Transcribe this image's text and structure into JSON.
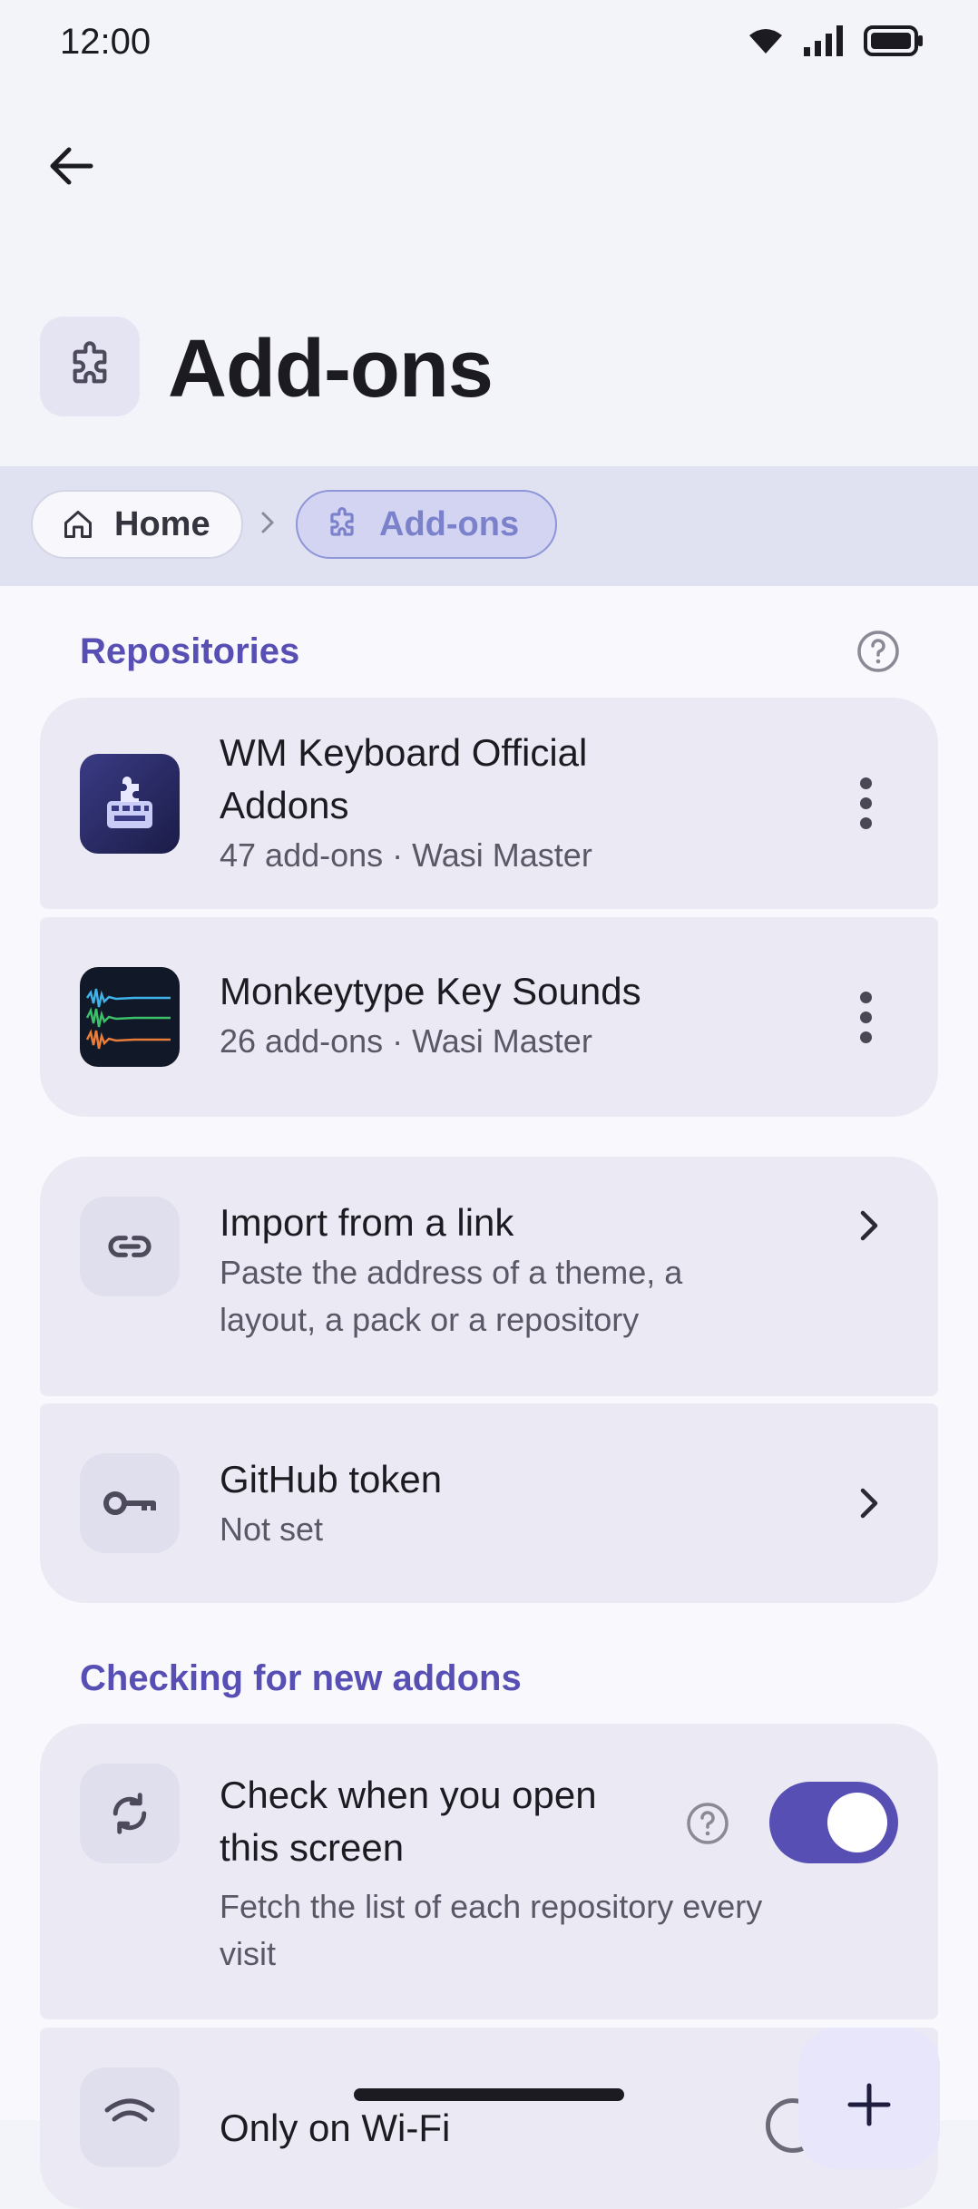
{
  "status_bar": {
    "time": "12:00"
  },
  "header": {
    "title": "Add-ons"
  },
  "breadcrumb": {
    "items": [
      {
        "label": "Home"
      },
      {
        "label": "Add-ons"
      }
    ]
  },
  "sections": {
    "repositories": {
      "title": "Repositories",
      "items": [
        {
          "title_line1": "WM Keyboard Official",
          "title_line2": "Addons",
          "subtitle": "47 add-ons · Wasi Master"
        },
        {
          "title": "Monkeytype Key Sounds",
          "subtitle": "26 add-ons · Wasi Master"
        }
      ]
    },
    "import": {
      "title": "Import from a link",
      "subtitle_line1": "Paste the address of a theme, a",
      "subtitle_line2": "layout, a pack or a repository"
    },
    "github_token": {
      "title": "GitHub token",
      "subtitle": "Not set"
    },
    "checking": {
      "title": "Checking for new addons",
      "check_on_open": {
        "title_line1": "Check when you open",
        "title_line2": "this screen",
        "subtitle_line1": "Fetch the list of each repository every",
        "subtitle_line2": "visit",
        "enabled": true
      },
      "wifi_only": {
        "title_partial": "Only on Wi-Fi"
      }
    }
  },
  "colors": {
    "accent": "#574fb4",
    "background": "#f8f8fd",
    "card": "#ebeaf4",
    "breadcrumb_band": "#e0e1f1"
  },
  "icons": [
    "arrow-left-icon",
    "puzzle-icon",
    "home-icon",
    "chevron-right-icon",
    "help-icon",
    "more-vert-icon",
    "link-icon",
    "key-icon",
    "sync-icon",
    "wifi-icon",
    "plus-icon"
  ]
}
